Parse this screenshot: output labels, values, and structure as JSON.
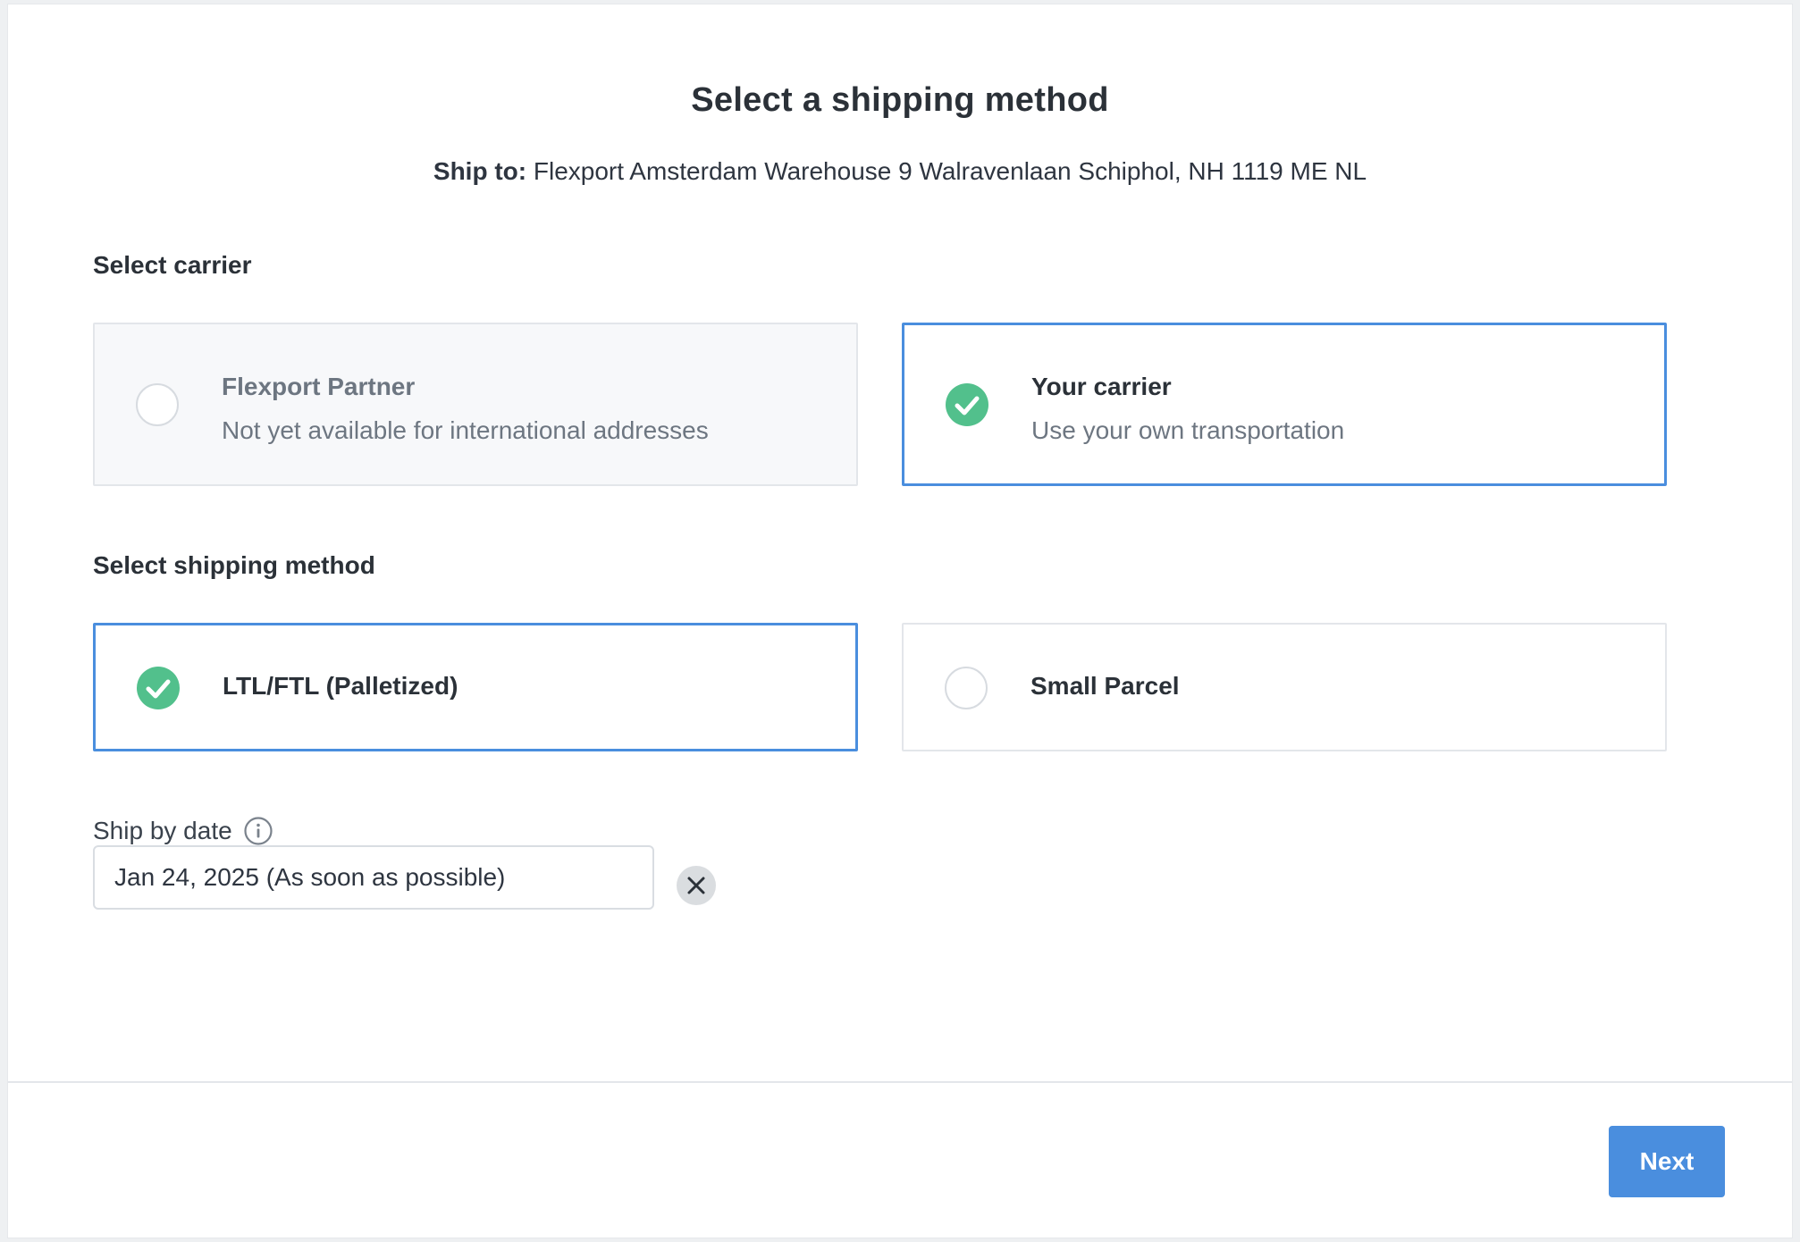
{
  "header": {
    "title": "Select a shipping method",
    "ship_to_label": "Ship to:",
    "ship_to_address": "Flexport Amsterdam Warehouse 9 Walravenlaan Schiphol, NH 1119 ME NL"
  },
  "carrier": {
    "section_label": "Select carrier",
    "options": [
      {
        "title": "Flexport Partner",
        "subtitle": "Not yet available for international addresses",
        "selected": false,
        "disabled": true
      },
      {
        "title": "Your carrier",
        "subtitle": "Use your own transportation",
        "selected": true,
        "disabled": false
      }
    ]
  },
  "shipping_method": {
    "section_label": "Select shipping method",
    "options": [
      {
        "title": "LTL/FTL (Palletized)",
        "selected": true
      },
      {
        "title": "Small Parcel",
        "selected": false
      }
    ]
  },
  "ship_by_date": {
    "label": "Ship by date",
    "value": "Jan 24, 2025 (As soon as possible)",
    "info_icon": "info-icon",
    "clear_icon": "close-icon"
  },
  "footer": {
    "next_label": "Next"
  },
  "colors": {
    "accent": "#4a8ede",
    "check_green": "#52c08c",
    "text_primary": "#2b3138",
    "text_muted": "#6d7681"
  }
}
